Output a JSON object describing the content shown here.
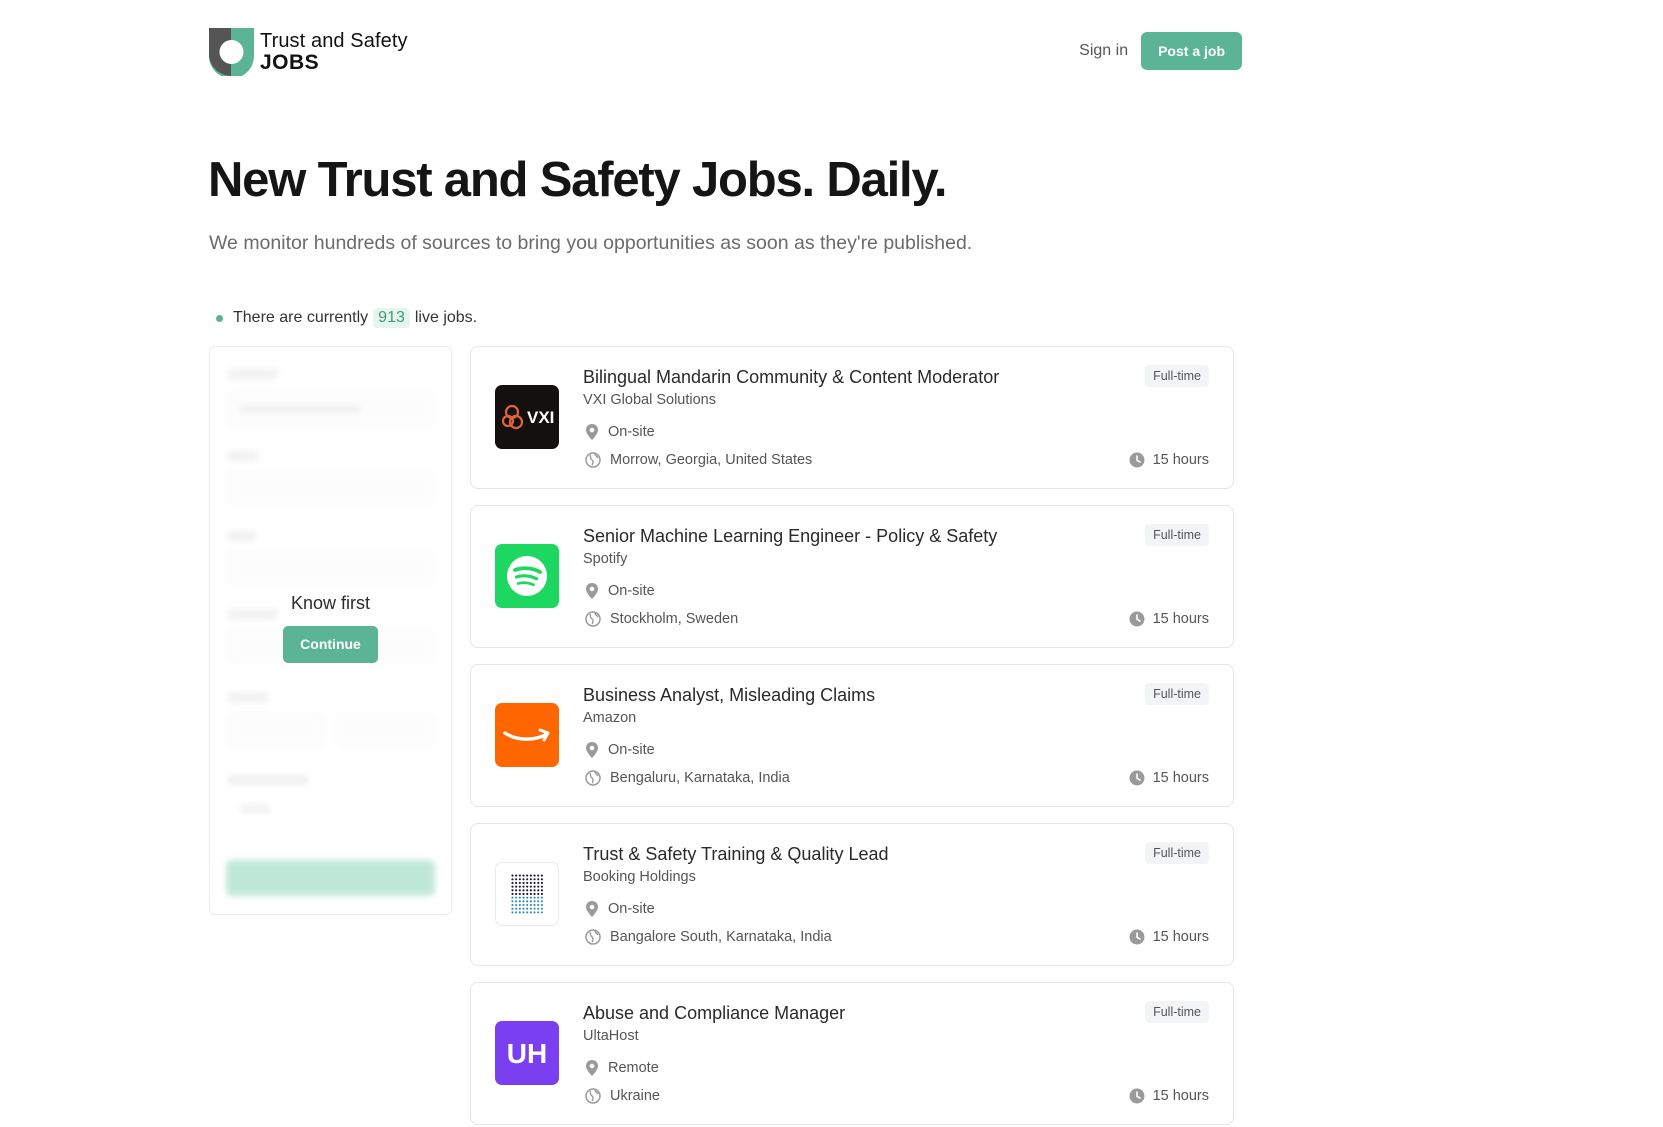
{
  "header": {
    "logo_line1": "Trust and Safety",
    "logo_line2": "JOBS",
    "sign_in": "Sign in",
    "post_job": "Post a job"
  },
  "hero": {
    "title": "New Trust and Safety Jobs. Daily.",
    "subtitle": "We monitor hundreds of sources to bring you opportunities as soon as they're published."
  },
  "live": {
    "prefix": "There are currently",
    "count": "913",
    "suffix": "live jobs."
  },
  "filter_panel": {
    "overlay_title": "Know first",
    "continue_label": "Continue"
  },
  "colors": {
    "accent": "#5cb496",
    "accent_light": "#e7f5ef"
  },
  "jobs": [
    {
      "title": "Bilingual Mandarin Community & Content Moderator",
      "company": "VXI Global Solutions",
      "mode": "On-site",
      "location": "Morrow, Georgia, United States",
      "type": "Full-time",
      "posted": "15 hours",
      "logo_text": "VXI",
      "logo_icon": "vxi-logo"
    },
    {
      "title": "Senior Machine Learning Engineer - Policy & Safety",
      "company": "Spotify",
      "mode": "On-site",
      "location": "Stockholm, Sweden",
      "type": "Full-time",
      "posted": "15 hours",
      "logo_text": "",
      "logo_icon": "spotify-logo"
    },
    {
      "title": "Business Analyst, Misleading Claims",
      "company": "Amazon",
      "mode": "On-site",
      "location": "Bengaluru, Karnataka, India",
      "type": "Full-time",
      "posted": "15 hours",
      "logo_text": "",
      "logo_icon": "amazon-logo"
    },
    {
      "title": "Trust & Safety Training & Quality Lead",
      "company": "Booking Holdings",
      "mode": "On-site",
      "location": "Bangalore South, Karnataka, India",
      "type": "Full-time",
      "posted": "15 hours",
      "logo_text": "",
      "logo_icon": "booking-holdings-logo"
    },
    {
      "title": "Abuse and Compliance Manager",
      "company": "UltaHost",
      "mode": "Remote",
      "location": "Ukraine",
      "type": "Full-time",
      "posted": "15 hours",
      "logo_text": "UH",
      "logo_icon": "ultahost-logo"
    }
  ]
}
